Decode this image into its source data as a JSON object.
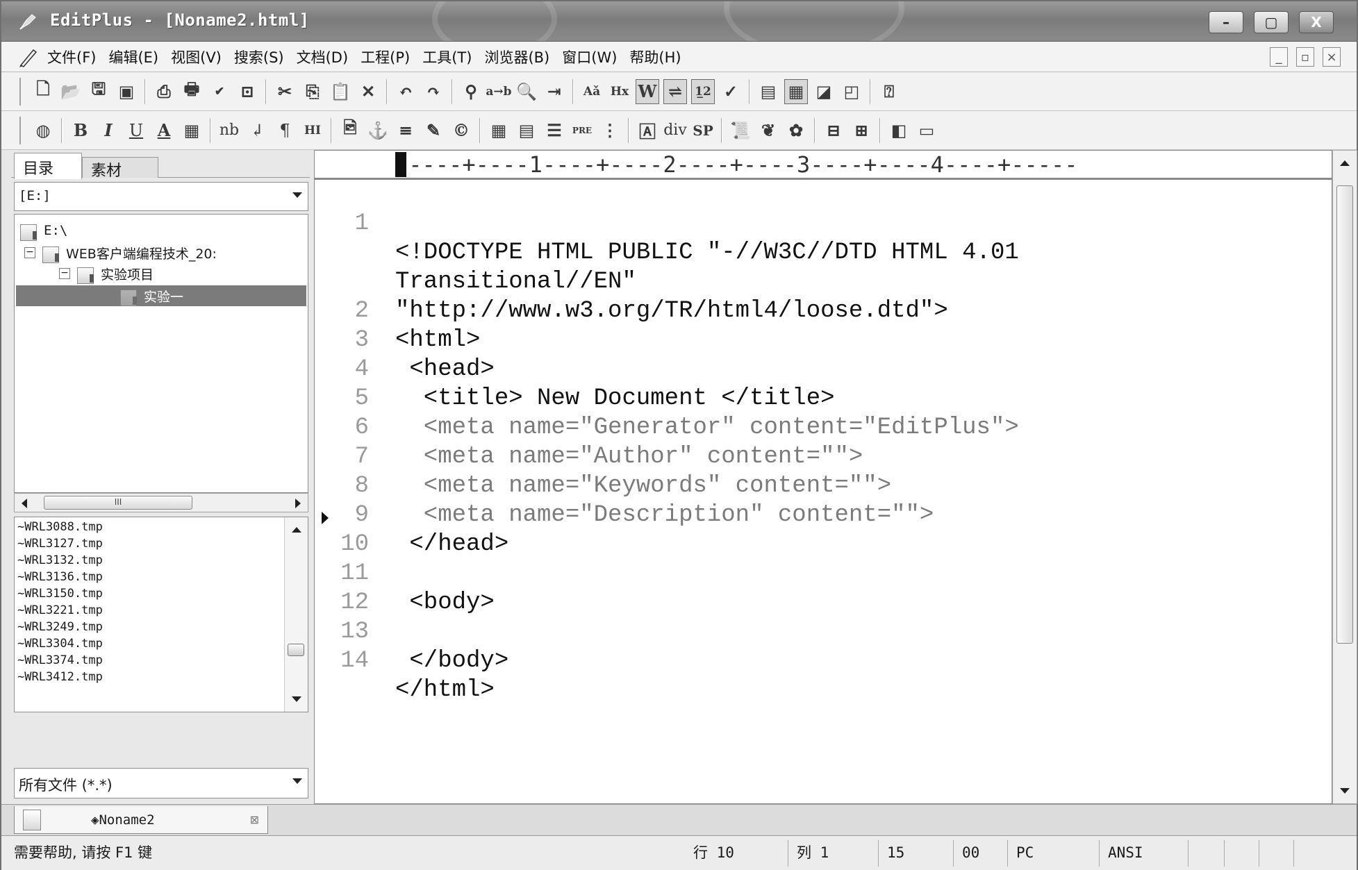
{
  "window": {
    "title": "EditPlus - [Noname2.html]",
    "minimize": "–",
    "maximize": "▢",
    "close": "X"
  },
  "menubar": {
    "items": [
      "文件(F)",
      "编辑(E)",
      "视图(V)",
      "搜索(S)",
      "文档(D)",
      "工程(P)",
      "工具(T)",
      "浏览器(B)",
      "窗口(W)",
      "帮助(H)"
    ],
    "mdi": {
      "minimize": "_",
      "restore": "▫",
      "close": "×"
    }
  },
  "toolbar2": {
    "bold": "B",
    "italic": "I",
    "underline": "U",
    "font": "A",
    "nb": "nb",
    "newline": "↲",
    "para": "¶",
    "hi": "HI",
    "pre": "PRE",
    "div": "div",
    "sp": "SP"
  },
  "sidebar": {
    "tabs": [
      "目录",
      "素材"
    ],
    "drive": "[E:]",
    "tree": [
      {
        "label": "E:\\",
        "indent": 0
      },
      {
        "label": "WEB客户端编程技术_20:",
        "indent": 1
      },
      {
        "label": "实验项目",
        "indent": 2
      },
      {
        "label": "实验一",
        "indent": 3,
        "selected": true
      }
    ],
    "files": [
      "~WRL3088.tmp",
      "~WRL3127.tmp",
      "~WRL3132.tmp",
      "~WRL3136.tmp",
      "~WRL3150.tmp",
      "~WRL3221.tmp",
      "~WRL3249.tmp",
      "~WRL3304.tmp",
      "~WRL3374.tmp",
      "~WRL3412.tmp"
    ],
    "filter": "所有文件 (*.*)",
    "hscroll_label": "III"
  },
  "editor": {
    "ruler": "-----+----1----+----2----+----3----+----4----+-----",
    "lines": [
      {
        "n": "1",
        "text": "<!DOCTYPE HTML PUBLIC \"-//W3C//DTD HTML 4.01"
      },
      {
        "n": "",
        "text": "Transitional//EN\""
      },
      {
        "n": "",
        "text": "\"http://www.w3.org/TR/html4/loose.dtd\">"
      },
      {
        "n": "2",
        "text": "<html>"
      },
      {
        "n": "3",
        "text": " <head>"
      },
      {
        "n": "4",
        "text": "  <title> New Document </title>"
      },
      {
        "n": "5",
        "text": "  <meta name=\"Generator\" content=\"EditPlus\">"
      },
      {
        "n": "6",
        "text": "  <meta name=\"Author\" content=\"\">"
      },
      {
        "n": "7",
        "text": "  <meta name=\"Keywords\" content=\"\">"
      },
      {
        "n": "8",
        "text": "  <meta name=\"Description\" content=\"\">"
      },
      {
        "n": "9",
        "text": " </head>"
      },
      {
        "n": "10",
        "text": ""
      },
      {
        "n": "11",
        "text": " <body>"
      },
      {
        "n": "12",
        "text": ""
      },
      {
        "n": "13",
        "text": " </body>"
      },
      {
        "n": "14",
        "text": "</html>"
      }
    ]
  },
  "doc_tab": {
    "label": "◈Noname2",
    "close": "⊠"
  },
  "status": {
    "help": "需要帮助, 请按 F1 键",
    "row": "行 10",
    "col": "列 1",
    "lines": "15",
    "code": "00",
    "mode": "PC",
    "encoding": "ANSI"
  }
}
